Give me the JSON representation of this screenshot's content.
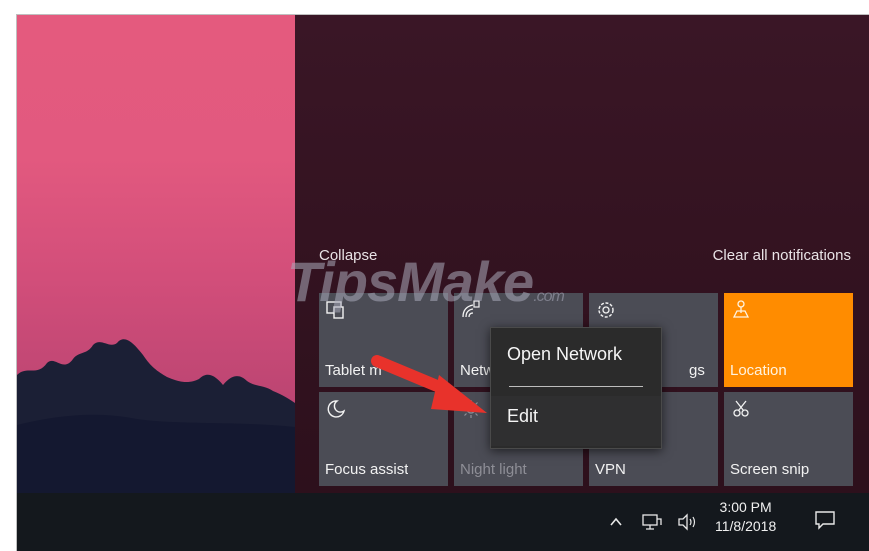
{
  "action_center": {
    "collapse_label": "Collapse",
    "clear_all_label": "Clear all notifications",
    "tiles": [
      {
        "id": "tablet",
        "label": "Tablet m",
        "icon": "tablet-mode-icon",
        "state": "normal"
      },
      {
        "id": "network",
        "label": "Netw",
        "icon": "network-icon",
        "state": "normal"
      },
      {
        "id": "settings",
        "label": "All settings",
        "icon": "gear-icon",
        "state": "normal"
      },
      {
        "id": "location",
        "label": "Location",
        "icon": "location-icon",
        "state": "active"
      },
      {
        "id": "focus",
        "label": "Focus assist",
        "icon": "moon-icon",
        "state": "normal"
      },
      {
        "id": "nightlight",
        "label": "Night light",
        "icon": "sun-icon",
        "state": "dim"
      },
      {
        "id": "vpn",
        "label": "VPN",
        "icon": "vpn-icon",
        "state": "normal"
      },
      {
        "id": "screensnip",
        "label": "Screen snip",
        "icon": "scissors-icon",
        "state": "normal"
      }
    ],
    "settings_visible_suffix": "gs"
  },
  "context_menu": {
    "items": [
      {
        "label": "Open Network"
      },
      {
        "label": "Edit"
      }
    ]
  },
  "watermark": {
    "text": "TipsMake",
    "suffix": ".com"
  },
  "taskbar": {
    "time": "3:00 PM",
    "date": "11/8/2018",
    "icons": [
      "chevron-up-icon",
      "network-tray-icon",
      "volume-icon",
      "action-center-icon"
    ]
  },
  "colors": {
    "accent": "#ff8c00",
    "tile_bg": "#4b4c55",
    "panel_bg": "#341321",
    "taskbar_bg": "#14181d",
    "arrow": "#e8322b"
  }
}
